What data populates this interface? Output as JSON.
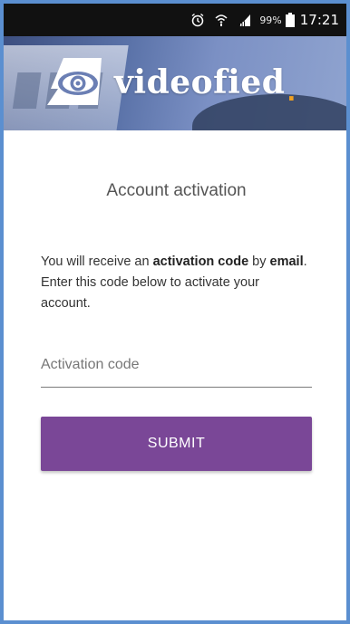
{
  "status_bar": {
    "icons": [
      "alarm-icon",
      "wifi-icon",
      "signal-icon",
      "battery-icon"
    ],
    "battery": "99%",
    "time": "17:21"
  },
  "banner": {
    "brand": "videofied",
    "accent_color": "#f0a020"
  },
  "page": {
    "title": "Account activation",
    "description": {
      "part1": "You will receive an ",
      "bold1": "activation code",
      "part2": " by ",
      "bold2": "email",
      "part3": ". Enter this code below to activate your account."
    }
  },
  "form": {
    "activation_code_placeholder": "Activation code",
    "activation_code_value": "",
    "submit_label": "SUBMIT",
    "submit_color": "#7a4797"
  }
}
